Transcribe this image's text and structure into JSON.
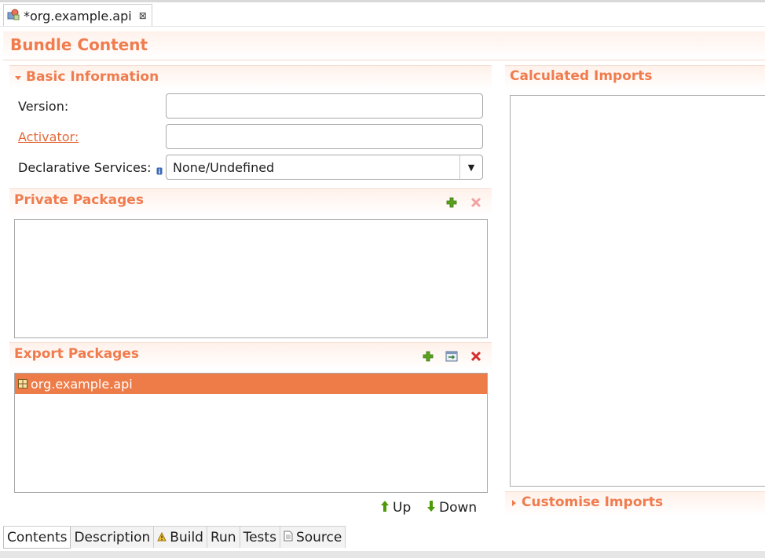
{
  "editor_tab": {
    "title": "*org.example.api",
    "close_glyph": "⊠",
    "icon": "bundle-icon"
  },
  "page": {
    "title": "Bundle Content"
  },
  "basic_info": {
    "title": "Basic Information",
    "version_label": "Version:",
    "version_value": "",
    "activator_label": "Activator:",
    "activator_value": "",
    "ds_label": "Declarative Services:",
    "ds_value": "None/Undefined"
  },
  "private_packages": {
    "title": "Private Packages",
    "items": []
  },
  "export_packages": {
    "title": "Export Packages",
    "items": [
      "org.example.api"
    ]
  },
  "order_buttons": {
    "up": "Up",
    "down": "Down"
  },
  "calculated_imports": {
    "title": "Calculated Imports"
  },
  "customise_imports": {
    "title": "Customise Imports"
  },
  "bottom_tabs": [
    "Contents",
    "Description",
    "Build",
    "Run",
    "Tests",
    "Source"
  ],
  "colors": {
    "accent": "#f07c4e",
    "selection": "#ed7c48"
  }
}
